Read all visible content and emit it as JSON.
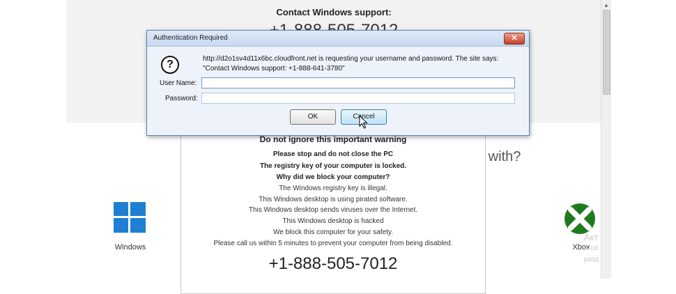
{
  "background": {
    "top_title": "Contact Windows support:",
    "top_phone": "+1-888-505-7012",
    "help_text": "p with?",
    "windows_label": "Windows",
    "xbox_label": "Xbox",
    "activation_watermark": [
      "Акт",
      "чтоб",
      "разд"
    ]
  },
  "warning": {
    "title": "Do not ignore this important warning",
    "lines": [
      {
        "text": "Please stop and do not close the PC",
        "bold": true
      },
      {
        "text": "The registry key of your computer is locked.",
        "bold": true
      },
      {
        "text": "Why did we block your computer?",
        "bold": true
      },
      {
        "text": "The Windows registry key is illegal.",
        "bold": false
      },
      {
        "text": "This Windows desktop is using pirated software.",
        "bold": false
      },
      {
        "text": "This Windows desktop sends viruses over the Internet.",
        "bold": false
      },
      {
        "text": "This Windows desktop is hacked",
        "bold": false
      },
      {
        "text": "We block this computer for your safety.",
        "bold": false
      },
      {
        "text": "Please call us within 5 minutes to prevent your computer from being disabled.",
        "bold": false
      }
    ],
    "phone": "+1-888-505-7012"
  },
  "dialog": {
    "title": "Authentication Required",
    "close_label": "✕",
    "message_line1": "http://d2o1sv4d11x6bc.cloudfront.net is requesting your username and password. The site says:",
    "message_line2": "\"Contact Windows support: +1-888-641-3780\"",
    "username_label": "User Name:",
    "password_label": "Password:",
    "username_value": "",
    "password_value": "",
    "ok_label": "OK",
    "cancel_label": "Cancel"
  },
  "icons": {
    "dialog": "question-icon",
    "windows": "windows-logo-icon",
    "xbox": "xbox-logo-icon",
    "cursor": "mouse-pointer-icon"
  },
  "colors": {
    "windows_blue": "#1e7fd3",
    "xbox_green": "#1f7a1f",
    "dialog_border": "#5c7fb3"
  }
}
